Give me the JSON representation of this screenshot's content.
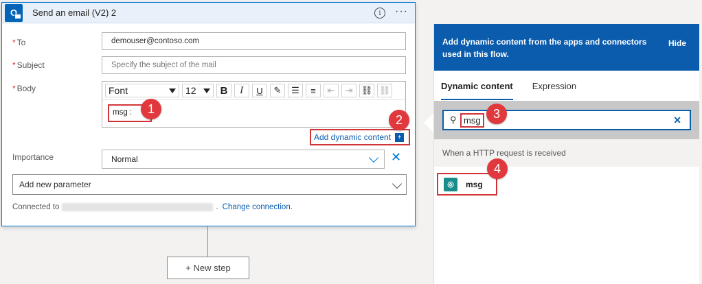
{
  "card": {
    "icon_letter": "O",
    "title": "Send an email (V2) 2",
    "info_icon": "info-icon",
    "more_icon": "more-icon"
  },
  "fields": {
    "to": {
      "label": "To",
      "value": "demouser@contoso.com"
    },
    "subject": {
      "label": "Subject",
      "placeholder": "Specify the subject of the mail"
    },
    "body": {
      "label": "Body",
      "token": "msg :"
    }
  },
  "toolbar": {
    "font": "Font",
    "size": "12",
    "bold": "B",
    "italic": "I",
    "underline": "U"
  },
  "dynamic_link": {
    "label": "Add dynamic content",
    "plus": "+"
  },
  "importance": {
    "label": "Importance",
    "value": "Normal"
  },
  "add_param": {
    "placeholder": "Add new parameter"
  },
  "connected": {
    "prefix": "Connected to",
    "change": "Change connection."
  },
  "new_step": {
    "label": "+ New step"
  },
  "badges": [
    "1",
    "2",
    "3",
    "4"
  ],
  "panel": {
    "header": "Add dynamic content from the apps and connectors used in this flow.",
    "hide": "Hide",
    "tabs": [
      "Dynamic content",
      "Expression"
    ],
    "search_value": "msg",
    "section": "When a HTTP request is received",
    "result": "msg"
  },
  "colors": {
    "accent": "#0b5cad",
    "highlight": "#d13438",
    "badge": "#e0383c"
  }
}
